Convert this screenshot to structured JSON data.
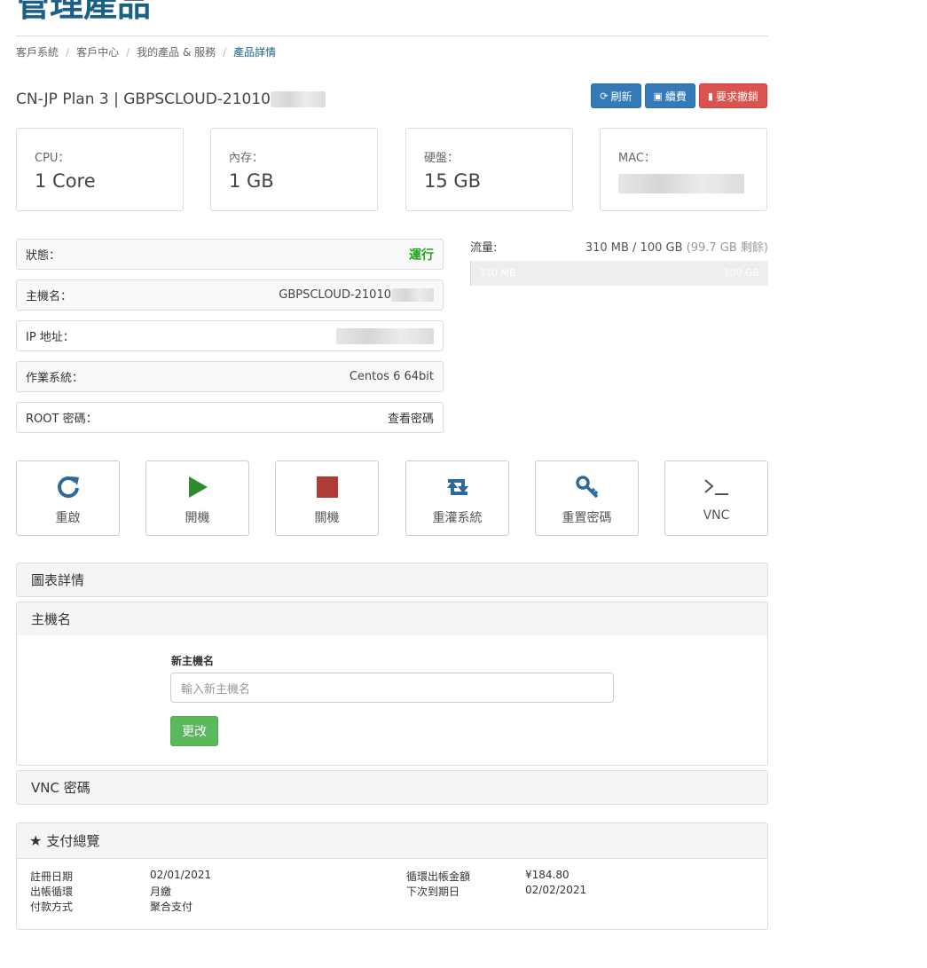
{
  "page": {
    "title": "管理產品"
  },
  "breadcrumb": [
    "客戶系統",
    "客戶中心",
    "我的產品 & 服務",
    "產品詳情"
  ],
  "product": {
    "name": "CN-JP Plan 3 | GBPSCLOUD-21010"
  },
  "header_buttons": {
    "refresh": "刷新",
    "renew": "續費",
    "cancel": "要求撤銷"
  },
  "specs": [
    {
      "label": "CPU：",
      "value": "1 Core"
    },
    {
      "label": "內存：",
      "value": "1 GB"
    },
    {
      "label": "硬盤：",
      "value": "15 GB"
    },
    {
      "label": "MAC：",
      "value": ""
    }
  ],
  "info": {
    "status_label": "狀態：",
    "status_value": "運行",
    "hostname_label": "主機名：",
    "hostname_value": "GBPSCLOUD-21010",
    "ip_label": "IP 地址：",
    "os_label": "作業系統：",
    "os_value": "Centos 6 64bit",
    "root_label": "ROOT 密碼：",
    "root_value": "查看密碼"
  },
  "traffic": {
    "label": "流量:",
    "used": "310 MB / 100 GB",
    "remaining": "(99.7 GB 剩餘)",
    "bar_min": "310 MB",
    "bar_max": "100 GB",
    "used_fraction": 0.003
  },
  "actions": [
    "重啟",
    "開機",
    "關機",
    "重灌系統",
    "重置密碼",
    "VNC"
  ],
  "panels": {
    "charts": "圖表詳情",
    "hostname": "主機名",
    "vnc": "VNC 密碼"
  },
  "hostname_form": {
    "label": "新主機名",
    "placeholder": "輸入新主機名",
    "submit": "更改"
  },
  "payment": {
    "title": "支付總覽",
    "reg_date_label": "註冊日期",
    "reg_date": "02/01/2021",
    "cycle_label": "出帳循環",
    "cycle": "月繳",
    "method_label": "付款方式",
    "method": "聚合支付",
    "amount_label": "循環出帳金額",
    "amount": "¥184.80",
    "due_label": "下次到期日",
    "due": "02/02/2021"
  },
  "colors": {
    "brand": "#1a5f86",
    "primary": "#337ab7",
    "danger": "#d9534f",
    "success": "#5cb85c",
    "status_running": "#1fa51f",
    "action_icon_blue": "#2d6a9a",
    "power_on_green": "#2e8b2e",
    "power_off_red": "#b03a34"
  }
}
